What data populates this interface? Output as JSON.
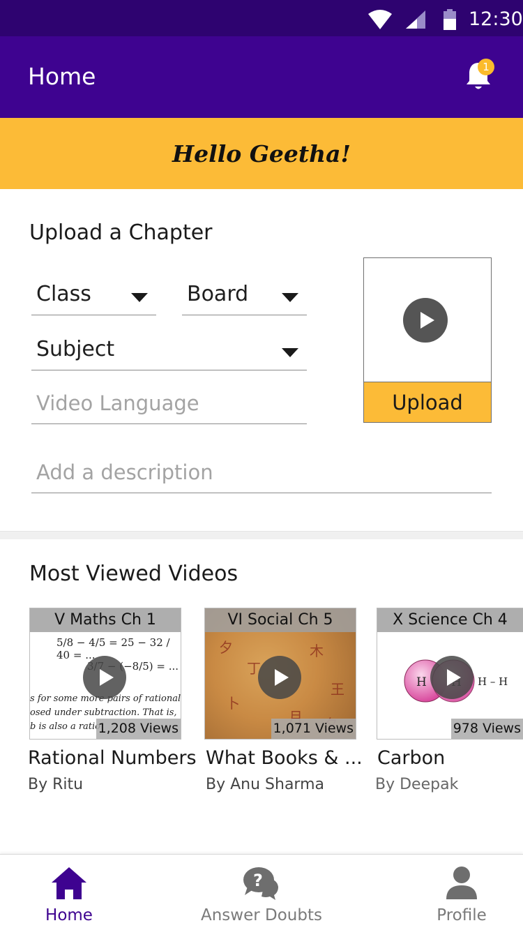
{
  "status_bar": {
    "time": "12:30"
  },
  "app_bar": {
    "title": "Home",
    "notification_count": "1"
  },
  "greeting": "Hello Geetha!",
  "upload": {
    "section_title": "Upload a Chapter",
    "class_label": "Class",
    "board_label": "Board",
    "subject_label": "Subject",
    "language_placeholder": "Video Language",
    "description_placeholder": "Add a description",
    "upload_button": "Upload"
  },
  "most_viewed": {
    "section_title": "Most Viewed Videos",
    "videos": [
      {
        "caption": "V Maths Ch 1",
        "views": "1,208 Views",
        "title": "Rational Numbers",
        "author": "By Ritu"
      },
      {
        "caption": "VI Social Ch 5",
        "views": "1,071 Views",
        "title": "What Books & ...",
        "author": "By Anu Sharma"
      },
      {
        "caption": "X Science Ch 4",
        "views": "978 Views",
        "title": "Carbon",
        "author": "By Deepak"
      }
    ],
    "math_preview": {
      "line1": "5/8 − 4/5 = 25 − 32 / 40 = ...",
      "line2": "3/7 − (−8/5) = ...",
      "text1": "s for some more pairs of rational nu",
      "text2": "osed under subtraction. That is,",
      "text3": "b is also a ratio"
    },
    "molecule_labels": {
      "atom": "H",
      "bond": "H – H"
    }
  },
  "bottom_nav": {
    "items": [
      {
        "label": "Home",
        "icon": "home-icon",
        "active": true
      },
      {
        "label": "Answer Doubts",
        "icon": "chat-question-icon",
        "active": false
      },
      {
        "label": "Profile",
        "icon": "person-icon",
        "active": false
      }
    ]
  },
  "colors": {
    "status_bar": "#2e0370",
    "app_bar": "#3e0390",
    "accent": "#fcbb37",
    "active_nav": "#3e0390",
    "inactive_nav": "#7a7a7a"
  }
}
